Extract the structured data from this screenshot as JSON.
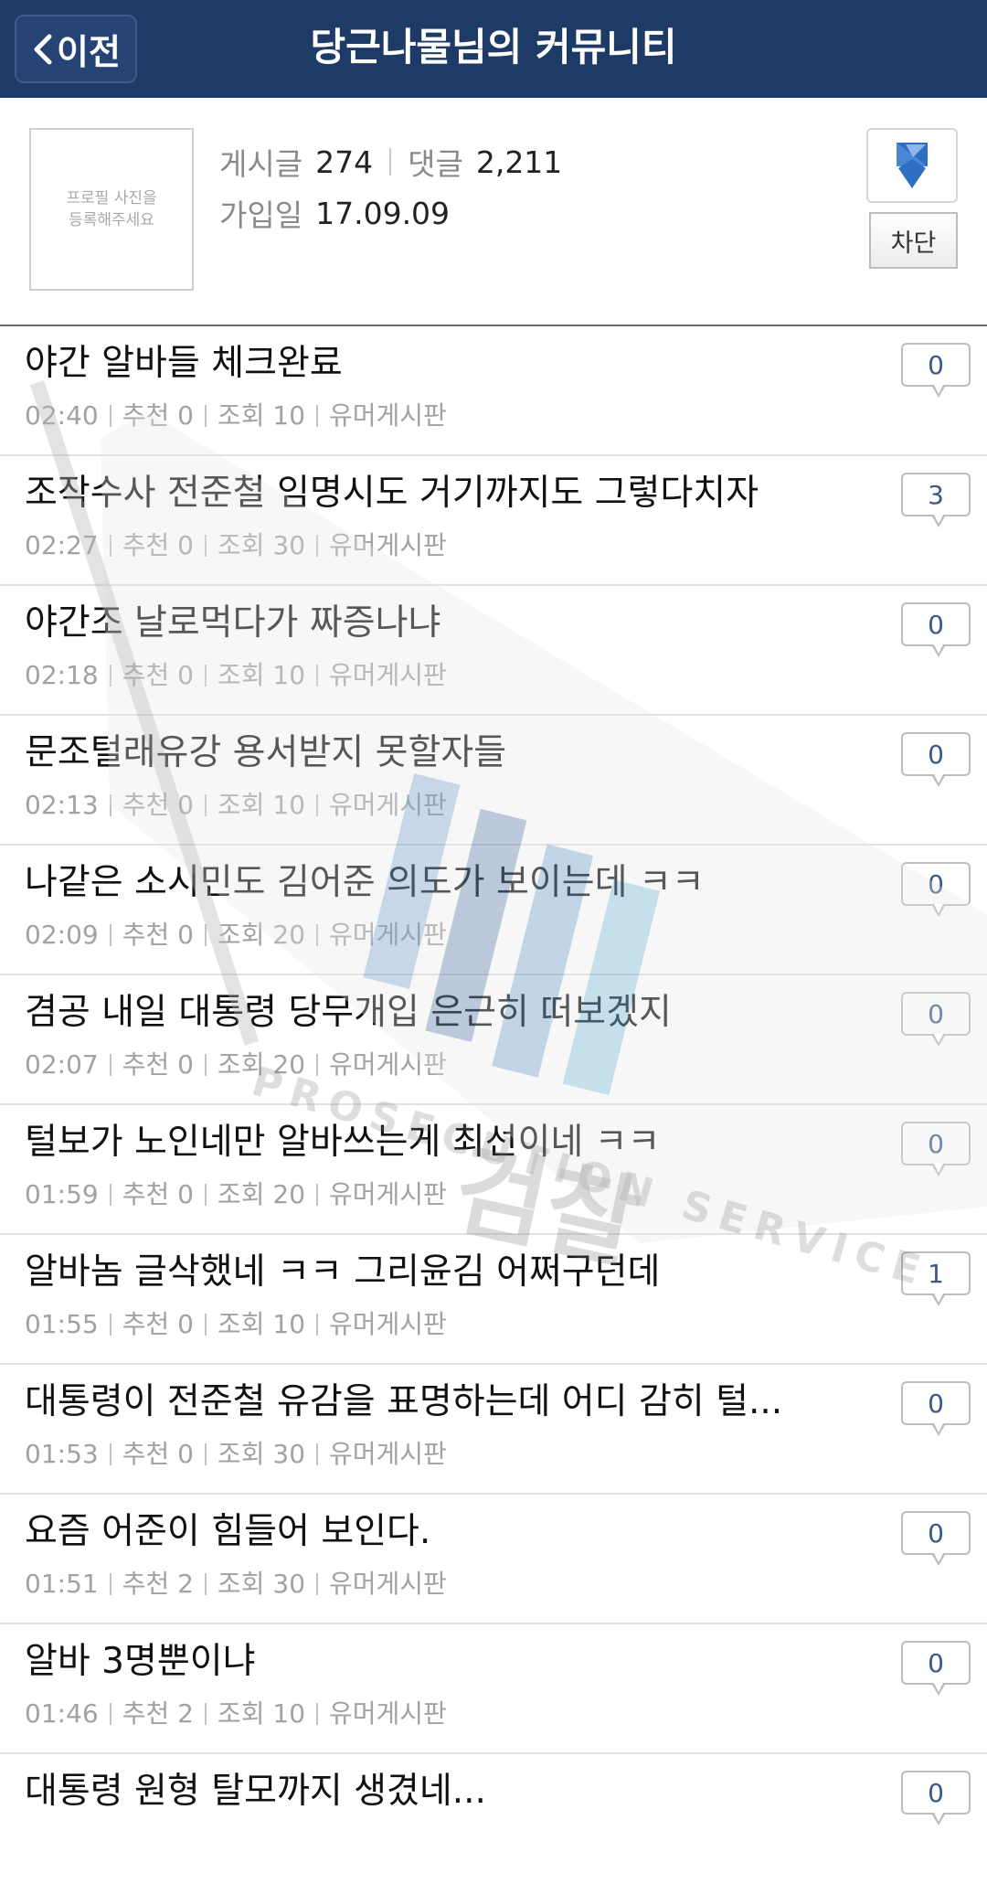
{
  "header": {
    "back_label": "이전",
    "title": "당근나물님의 커뮤니티"
  },
  "profile": {
    "avatar_placeholder_line1": "프로필 사진을",
    "avatar_placeholder_line2": "등록해주세요",
    "posts_label": "게시글",
    "posts_count": "274",
    "comments_label": "댓글",
    "comments_count": "2,211",
    "joined_label": "가입일",
    "joined_date": "17.09.09",
    "block_label": "차단",
    "ribbon_icon": "ribbon-icon",
    "ribbon_color": "#2f6fc0"
  },
  "posts": [
    {
      "title": "야간 알바들 체크완료",
      "time": "02:40",
      "recommend": "추천 0",
      "views": "조회 10",
      "board": "유머게시판",
      "comments": "0"
    },
    {
      "title": "조작수사 전준철 임명시도 거기까지도 그렇다치자",
      "time": "02:27",
      "recommend": "추천 0",
      "views": "조회 30",
      "board": "유머게시판",
      "comments": "3"
    },
    {
      "title": "야간조 날로먹다가 짜증나냐",
      "time": "02:18",
      "recommend": "추천 0",
      "views": "조회 10",
      "board": "유머게시판",
      "comments": "0"
    },
    {
      "title": "문조털래유강 용서받지 못할자들",
      "time": "02:13",
      "recommend": "추천 0",
      "views": "조회 10",
      "board": "유머게시판",
      "comments": "0"
    },
    {
      "title": "나같은 소시민도 김어준 의도가 보이는데 ㅋㅋ",
      "time": "02:09",
      "recommend": "추천 0",
      "views": "조회 20",
      "board": "유머게시판",
      "comments": "0"
    },
    {
      "title": "겸공 내일 대통령 당무개입 은근히 떠보겠지",
      "time": "02:07",
      "recommend": "추천 0",
      "views": "조회 20",
      "board": "유머게시판",
      "comments": "0"
    },
    {
      "title": "털보가 노인네만 알바쓰는게 최선이네 ㅋㅋ",
      "time": "01:59",
      "recommend": "추천 0",
      "views": "조회 20",
      "board": "유머게시판",
      "comments": "0"
    },
    {
      "title": "알바놈 글삭했네 ㅋㅋ 그리윤김 어쩌구던데",
      "time": "01:55",
      "recommend": "추천 0",
      "views": "조회 10",
      "board": "유머게시판",
      "comments": "1"
    },
    {
      "title": "대통령이 전준철 유감을 표명하는데 어디 감히 털...",
      "time": "01:53",
      "recommend": "추천 0",
      "views": "조회 30",
      "board": "유머게시판",
      "comments": "0"
    },
    {
      "title": "요즘 어준이 힘들어 보인다.",
      "time": "01:51",
      "recommend": "추천 2",
      "views": "조회 30",
      "board": "유머게시판",
      "comments": "0"
    },
    {
      "title": "알바 3명뿐이냐",
      "time": "01:46",
      "recommend": "추천 2",
      "views": "조회 10",
      "board": "유머게시판",
      "comments": "0"
    },
    {
      "title": "대통령 원형 탈모까지 생겼네...",
      "time": "",
      "recommend": "",
      "views": "",
      "board": "",
      "comments": "0"
    }
  ],
  "watermark": {
    "text_ko": "검찰",
    "text_en": "PROSECUTION SERVICE"
  }
}
